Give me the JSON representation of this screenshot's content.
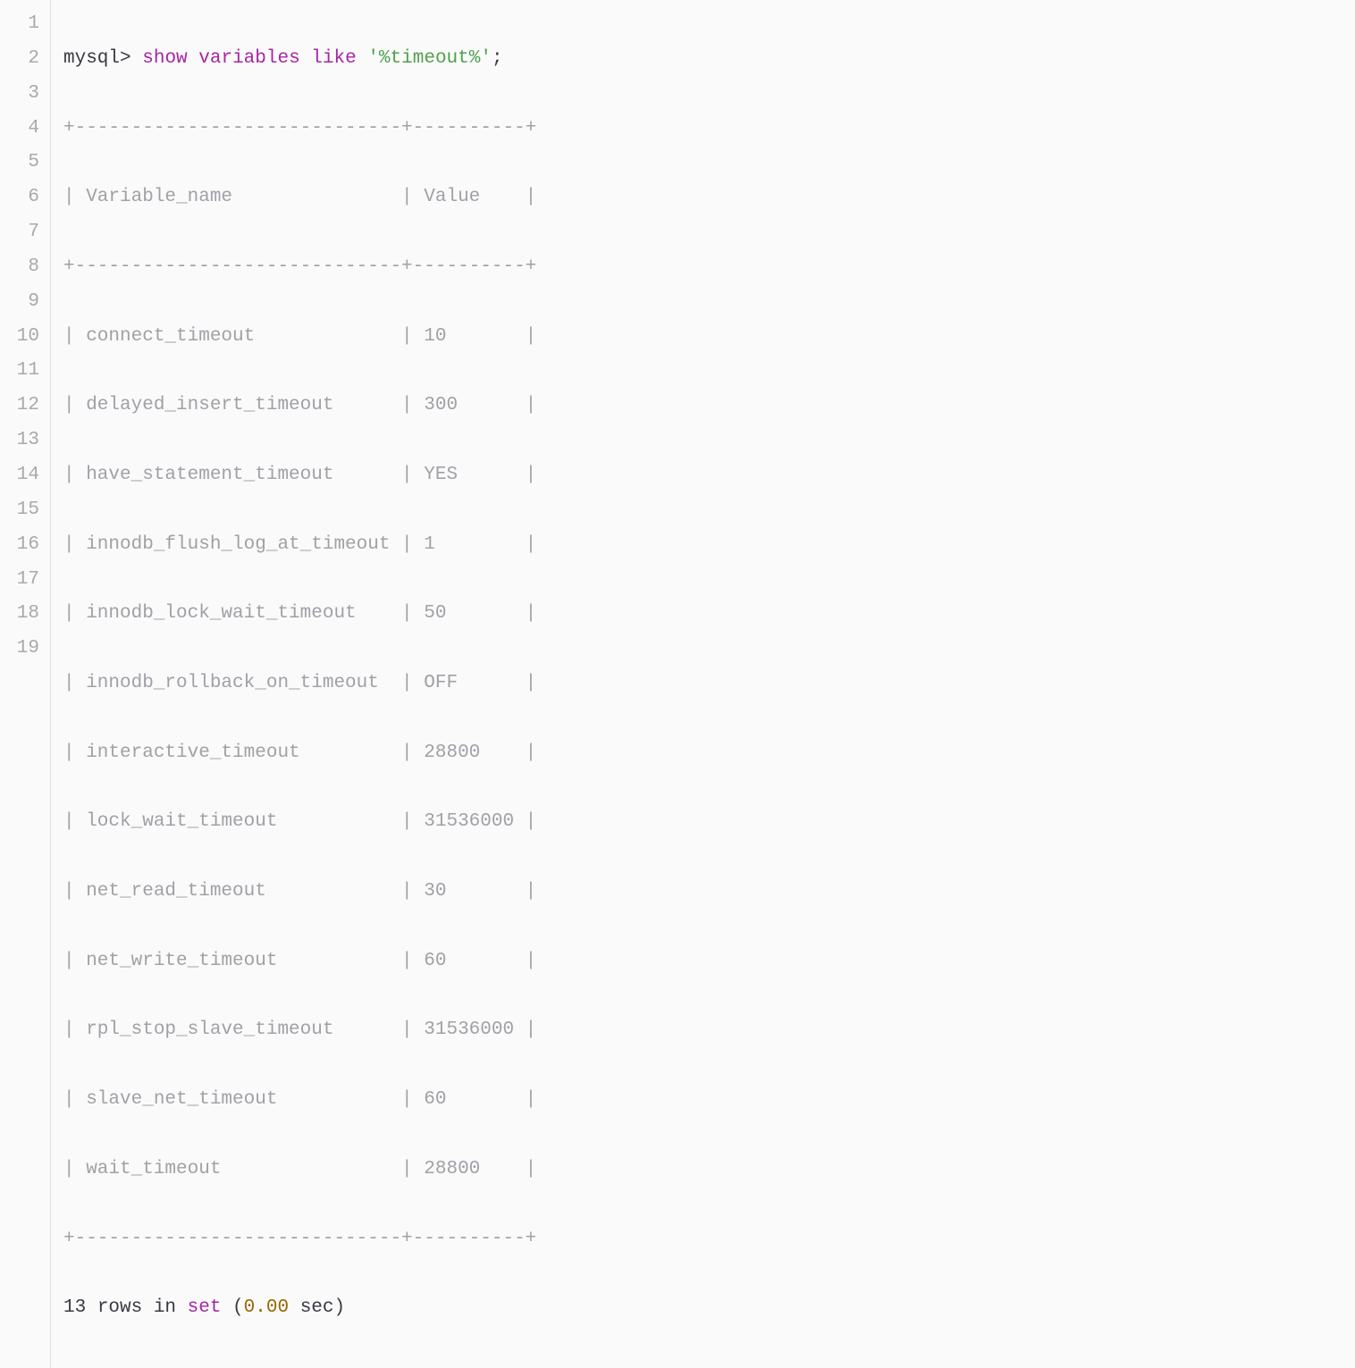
{
  "prompt": "mysql>",
  "command": {
    "kw1": "show",
    "kw2": "variables",
    "kw3": "like",
    "arg": "'%timeout%'",
    "term": ";"
  },
  "border": "+-----------------------------+----------+",
  "header": "| Variable_name               | Value    |",
  "rows": [
    "| connect_timeout             | 10       |",
    "| delayed_insert_timeout      | 300      |",
    "| have_statement_timeout      | YES      |",
    "| innodb_flush_log_at_timeout | 1        |",
    "| innodb_lock_wait_timeout    | 50       |",
    "| innodb_rollback_on_timeout  | OFF      |",
    "| interactive_timeout         | 28800    |",
    "| lock_wait_timeout           | 31536000 |",
    "| net_read_timeout            | 30       |",
    "| net_write_timeout           | 60       |",
    "| rpl_stop_slave_timeout      | 31536000 |",
    "| slave_net_timeout           | 60       |",
    "| wait_timeout                | 28800    |"
  ],
  "footer": {
    "count": "13",
    "t1": " rows in ",
    "setkw": "set",
    "t2": " (",
    "time": "0.00",
    "t3": " sec)"
  },
  "lineNumbers": [
    "1",
    "2",
    "3",
    "4",
    "5",
    "6",
    "7",
    "8",
    "9",
    "10",
    "11",
    "12",
    "13",
    "14",
    "15",
    "16",
    "17",
    "18",
    "19"
  ]
}
